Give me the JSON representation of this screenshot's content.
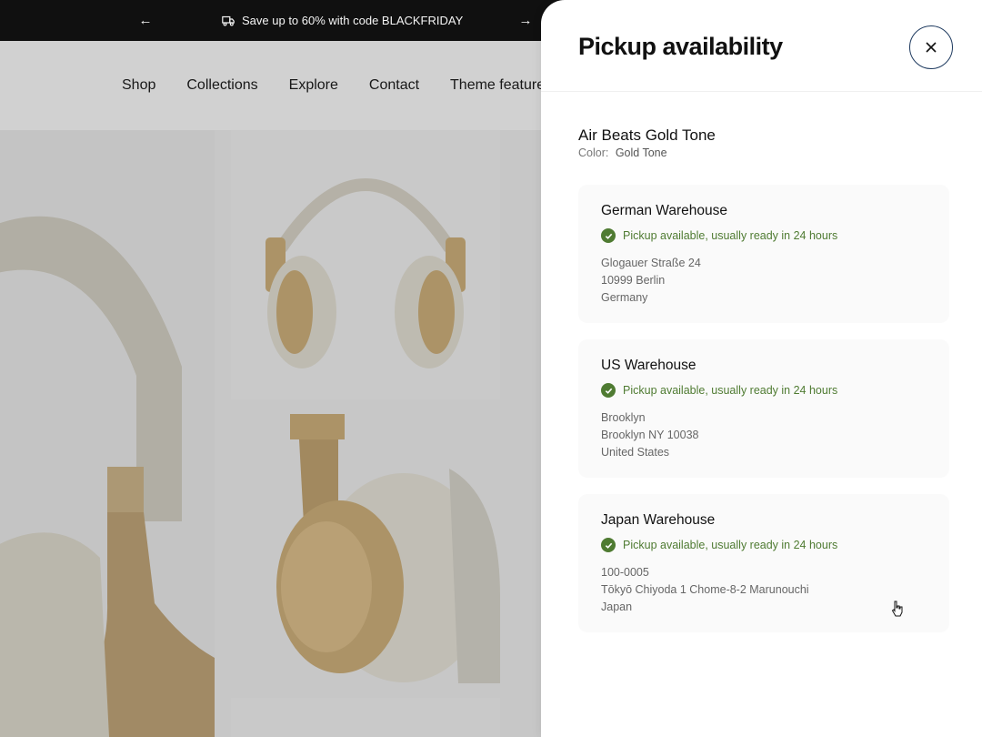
{
  "announcement": {
    "message": "Save up to 60% with code BLACKFRIDAY",
    "icon": "truck-icon"
  },
  "nav": {
    "items": [
      "Shop",
      "Collections",
      "Explore",
      "Contact",
      "Theme feature"
    ]
  },
  "drawer": {
    "title": "Pickup availability",
    "product": {
      "name": "Air Beats Gold Tone",
      "variant_label": "Color:",
      "variant_value": "Gold Tone"
    },
    "locations": [
      {
        "name": "German Warehouse",
        "status": "Pickup available, usually ready in 24 hours",
        "address": [
          "Glogauer Straße 24",
          "10999 Berlin",
          "Germany"
        ]
      },
      {
        "name": "US Warehouse",
        "status": "Pickup available, usually ready in 24 hours",
        "address": [
          "Brooklyn",
          "Brooklyn NY 10038",
          "United States"
        ]
      },
      {
        "name": "Japan Warehouse",
        "status": "Pickup available, usually ready in 24 hours",
        "address": [
          "100-0005",
          "Tōkyō Chiyoda 1 Chome-8-2 Marunouchi",
          "Japan"
        ]
      }
    ]
  },
  "colors": {
    "announcement_bg": "#111111",
    "status_green": "#4f7b32",
    "close_border": "#1e3a5f",
    "product_gold": "#b89a6a"
  }
}
